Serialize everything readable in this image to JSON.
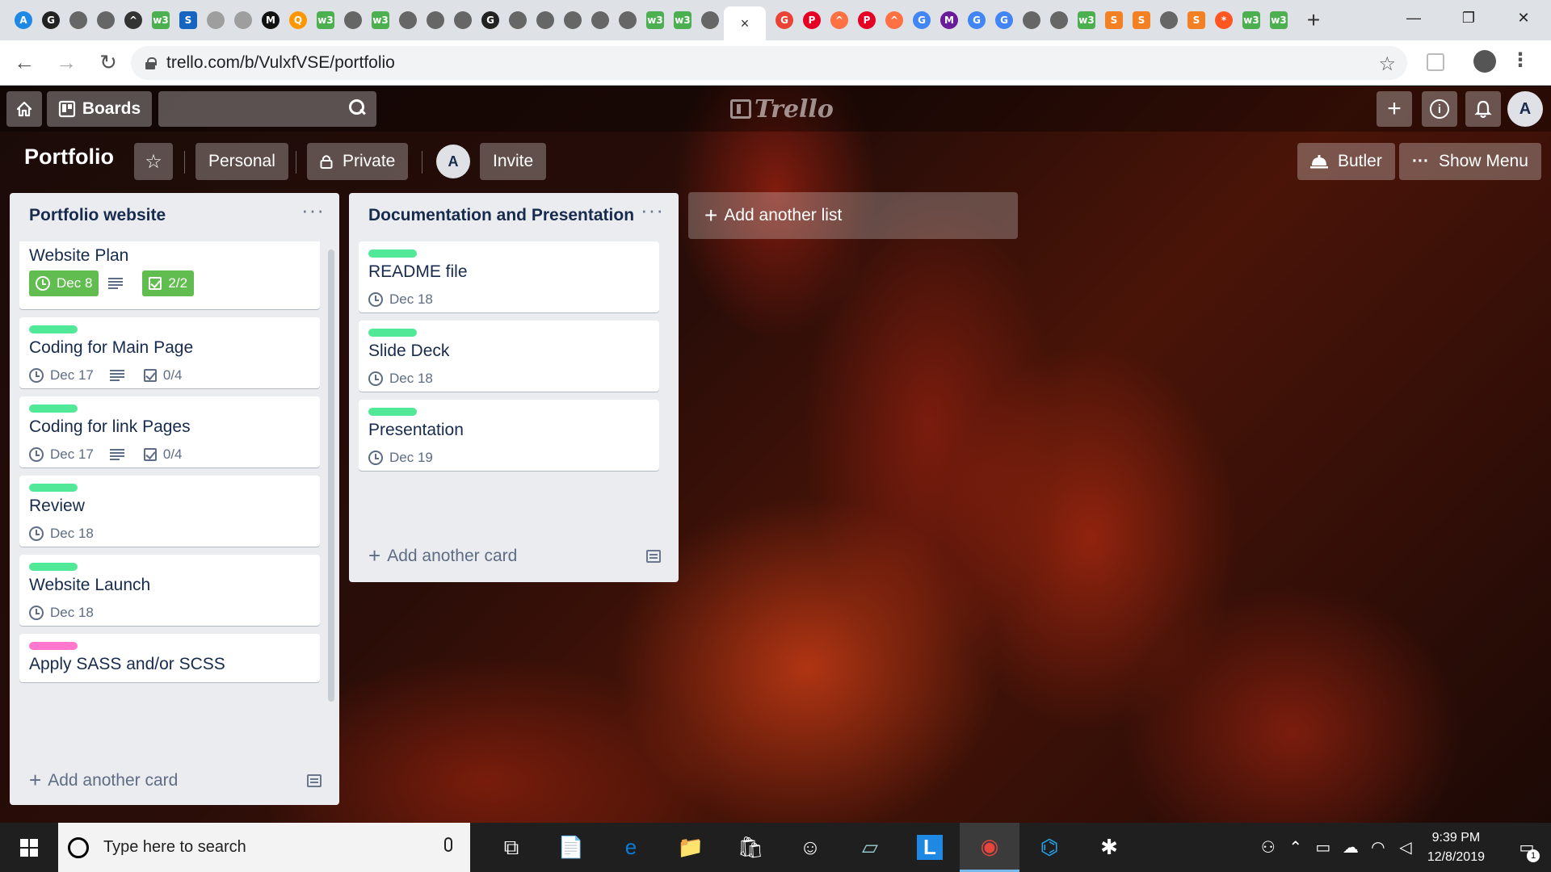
{
  "browser": {
    "tabs": [
      {
        "icon": "site-icon",
        "color": "#1e88e5",
        "glyph": "A"
      },
      {
        "icon": "github-icon",
        "color": "#222222",
        "glyph": "G"
      },
      {
        "icon": "globe-icon",
        "color": "#666666",
        "glyph": ""
      },
      {
        "icon": "globe-icon",
        "color": "#666666",
        "glyph": ""
      },
      {
        "icon": "site-icon",
        "color": "#333333",
        "glyph": "^"
      },
      {
        "icon": "w3schools-icon",
        "color": "#4caf50",
        "glyph": "w3"
      },
      {
        "icon": "site-icon",
        "color": "#1565c0",
        "glyph": "S"
      },
      {
        "icon": "site-icon",
        "color": "#9e9e9e",
        "glyph": ""
      },
      {
        "icon": "site-icon",
        "color": "#9e9e9e",
        "glyph": ""
      },
      {
        "icon": "mail-icon",
        "color": "#111111",
        "glyph": "M"
      },
      {
        "icon": "search-icon",
        "color": "#ff9800",
        "glyph": "Q"
      },
      {
        "icon": "w3schools-icon",
        "color": "#4caf50",
        "glyph": "w3"
      },
      {
        "icon": "globe-icon",
        "color": "#666666",
        "glyph": ""
      },
      {
        "icon": "w3schools-icon",
        "color": "#4caf50",
        "glyph": "w3"
      },
      {
        "icon": "globe-icon",
        "color": "#666666",
        "glyph": ""
      },
      {
        "icon": "globe-icon",
        "color": "#666666",
        "glyph": ""
      },
      {
        "icon": "globe-icon",
        "color": "#666666",
        "glyph": ""
      },
      {
        "icon": "github-icon",
        "color": "#222222",
        "glyph": "G"
      },
      {
        "icon": "globe-icon",
        "color": "#666666",
        "glyph": ""
      },
      {
        "icon": "globe-icon",
        "color": "#666666",
        "glyph": ""
      },
      {
        "icon": "globe-icon",
        "color": "#666666",
        "glyph": ""
      },
      {
        "icon": "globe-icon",
        "color": "#666666",
        "glyph": ""
      },
      {
        "icon": "globe-icon",
        "color": "#666666",
        "glyph": ""
      },
      {
        "icon": "w3schools-icon",
        "color": "#4caf50",
        "glyph": "w3"
      },
      {
        "icon": "w3schools-icon",
        "color": "#4caf50",
        "glyph": "w3"
      },
      {
        "icon": "globe-icon",
        "color": "#666666",
        "glyph": ""
      }
    ],
    "active_tab_close": "×",
    "tabs_after": [
      {
        "icon": "google-icon",
        "color": "#ea4335",
        "glyph": "G"
      },
      {
        "icon": "pinterest-icon",
        "color": "#e60023",
        "glyph": "P"
      },
      {
        "icon": "butler-icon",
        "color": "#ff7043",
        "glyph": "^"
      },
      {
        "icon": "pinterest-icon",
        "color": "#e60023",
        "glyph": "P"
      },
      {
        "icon": "butler-icon",
        "color": "#ff7043",
        "glyph": "^"
      },
      {
        "icon": "google-icon",
        "color": "#4285f4",
        "glyph": "G"
      },
      {
        "icon": "mail-icon",
        "color": "#6a1b9a",
        "glyph": "M"
      },
      {
        "icon": "google-icon",
        "color": "#4285f4",
        "glyph": "G"
      },
      {
        "icon": "google-icon",
        "color": "#4285f4",
        "glyph": "G"
      },
      {
        "icon": "globe-icon",
        "color": "#666666",
        "glyph": ""
      },
      {
        "icon": "globe-icon",
        "color": "#666666",
        "glyph": ""
      },
      {
        "icon": "w3schools-icon",
        "color": "#4caf50",
        "glyph": "w3"
      },
      {
        "icon": "stackoverflow-icon",
        "color": "#f48024",
        "glyph": "S"
      },
      {
        "icon": "stackoverflow-icon",
        "color": "#f48024",
        "glyph": "S"
      },
      {
        "icon": "globe-icon",
        "color": "#666666",
        "glyph": ""
      },
      {
        "icon": "stackoverflow-icon",
        "color": "#f48024",
        "glyph": "S"
      },
      {
        "icon": "asterisk-icon",
        "color": "#ff5722",
        "glyph": "*"
      },
      {
        "icon": "w3schools-icon",
        "color": "#4caf50",
        "glyph": "w3"
      },
      {
        "icon": "w3schools-icon",
        "color": "#4caf50",
        "glyph": "w3"
      }
    ],
    "new_tab": "+",
    "window_controls": {
      "minimize": "—",
      "restore": "❐",
      "close": "✕"
    },
    "nav": {
      "back": "←",
      "forward": "→",
      "reload": "↻"
    },
    "url": "trello.com/b/VulxfVSE/portfolio",
    "bookmark": "☆",
    "menu": "⋮"
  },
  "trello": {
    "header": {
      "boards_label": "Boards",
      "logo_text": "Trello",
      "avatar_initial": "A",
      "create": "+",
      "info": "i",
      "notifications": "🔔"
    },
    "board": {
      "title": "Portfolio",
      "star": "☆",
      "team": "Personal",
      "visibility": "Private",
      "member_initial": "A",
      "invite": "Invite",
      "butler": "Butler",
      "show_menu": "Show Menu",
      "more": "···"
    },
    "label_colors": {
      "green": "#61bd4f",
      "mint": "#51e898",
      "pink": "#ff78cb"
    },
    "lists": [
      {
        "title": "Portfolio website",
        "menu": "···",
        "add_card": "Add another card",
        "cards": [
          {
            "title": "Website Plan",
            "due": "Dec 8",
            "due_done": true,
            "has_description": true,
            "checklist": "2/2",
            "checklist_done": true
          },
          {
            "title": "Coding for Main Page",
            "label": "mint",
            "due": "Dec 17",
            "has_description": true,
            "checklist": "0/4"
          },
          {
            "title": "Coding for link Pages",
            "label": "mint",
            "due": "Dec 17",
            "has_description": true,
            "checklist": "0/4"
          },
          {
            "title": "Review",
            "label": "mint",
            "due": "Dec 18"
          },
          {
            "title": "Website Launch",
            "label": "mint",
            "due": "Dec 18"
          },
          {
            "title": "Apply SASS and/or SCSS",
            "label": "pink"
          }
        ]
      },
      {
        "title": "Documentation and Presentation",
        "menu": "···",
        "add_card": "Add another card",
        "cards": [
          {
            "title": "README file",
            "label": "mint",
            "due": "Dec 18"
          },
          {
            "title": "Slide Deck",
            "label": "mint",
            "due": "Dec 18"
          },
          {
            "title": "Presentation",
            "label": "mint",
            "due": "Dec 19"
          }
        ]
      }
    ],
    "add_list": "Add another list"
  },
  "taskbar": {
    "search_placeholder": "Type here to search",
    "apps": [
      {
        "name": "task-view-icon",
        "glyph": "⧉"
      },
      {
        "name": "file-icon",
        "glyph": "📄"
      },
      {
        "name": "edge-icon",
        "glyph": "e"
      },
      {
        "name": "file-explorer-icon",
        "glyph": "📁"
      },
      {
        "name": "store-icon",
        "glyph": "🛍"
      },
      {
        "name": "emoji-app-icon",
        "glyph": "☺"
      },
      {
        "name": "notes-icon",
        "glyph": "▱"
      },
      {
        "name": "l-app-icon",
        "glyph": "L"
      },
      {
        "name": "chrome-icon",
        "glyph": "◉"
      },
      {
        "name": "vscode-icon",
        "glyph": "⌬"
      },
      {
        "name": "slack-icon",
        "glyph": "✱"
      }
    ],
    "time": "9:39 PM",
    "date": "12/8/2019",
    "notifications_count": "1"
  }
}
